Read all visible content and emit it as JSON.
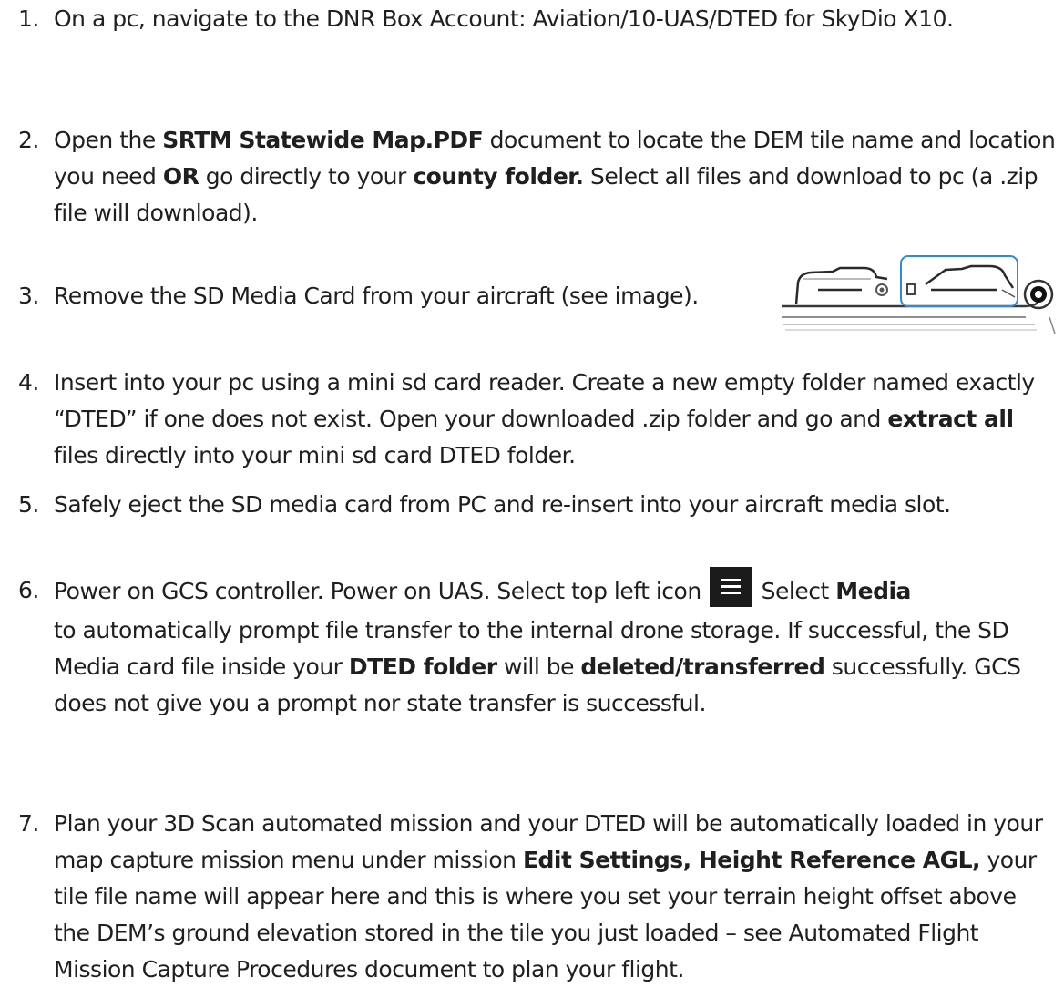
{
  "steps": [
    {
      "number": "1.",
      "segments": [
        {
          "text": "On a pc, navigate to the DNR Box Account: Aviation/10-UAS/DTED for SkyDio X10.",
          "bold": false
        }
      ]
    },
    {
      "number": "2.",
      "segments": [
        {
          "text": "Open the ",
          "bold": false
        },
        {
          "text": "SRTM Statewide Map.PDF",
          "bold": true
        },
        {
          "text": " document to locate the DEM tile name and location you need ",
          "bold": false
        },
        {
          "text": "OR",
          "bold": true
        },
        {
          "text": " go directly to your ",
          "bold": false
        },
        {
          "text": "county folder.",
          "bold": true
        },
        {
          "text": " Select all files and download to pc (a .zip file will download).",
          "bold": false
        }
      ]
    },
    {
      "number": "3.",
      "segments": [
        {
          "text": "Remove the SD Media Card from your aircraft (see image).",
          "bold": false
        }
      ]
    },
    {
      "number": "4.",
      "segments": [
        {
          "text": "Insert into your pc using a mini sd card reader. Create a new empty folder named exactly “DTED” if one does not exist. Open your downloaded .zip folder and go and ",
          "bold": false
        },
        {
          "text": "extract all",
          "bold": true
        },
        {
          "text": " files directly into your mini sd card DTED folder.",
          "bold": false
        }
      ]
    },
    {
      "number": "5.",
      "segments": [
        {
          "text": "Safely eject the SD media card from PC and re-insert into your aircraft media slot.",
          "bold": false
        }
      ]
    },
    {
      "number": "6.",
      "first_line": "Power on GCS controller. Power on UAS. Select top left icon",
      "select_word": "Select",
      "media_word": "Media",
      "segments": [
        {
          "text": "to automatically prompt file transfer to the internal drone storage. If successful, the SD Media card file inside your ",
          "bold": false
        },
        {
          "text": "DTED folder",
          "bold": true
        },
        {
          "text": " will be ",
          "bold": false
        },
        {
          "text": "deleted/transferred",
          "bold": true
        },
        {
          "text": " successfully.  GCS does not give you a prompt nor state transfer is successful.",
          "bold": false
        }
      ]
    },
    {
      "number": "7.",
      "segments": [
        {
          "text": "Plan your 3D Scan automated mission and your DTED will be automatically loaded in your map capture mission menu under mission ",
          "bold": false
        },
        {
          "text": "Edit Settings, Height Reference AGL,",
          "bold": true
        },
        {
          "text": " your tile file name will appear here and this is where you set your terrain height offset above the DEM’s ground elevation stored in the tile you just loaded – see Automated Flight Mission Capture Procedures document to plan your flight.",
          "bold": false
        }
      ]
    }
  ],
  "icons": {
    "menu": "hamburger-menu-icon",
    "photo": "aircraft-sd-card-slot-photo"
  },
  "colors": {
    "text": "#1f1f1f",
    "highlight_box": "#2f8ad8",
    "menu_icon_bg": "#1b1b1b"
  }
}
